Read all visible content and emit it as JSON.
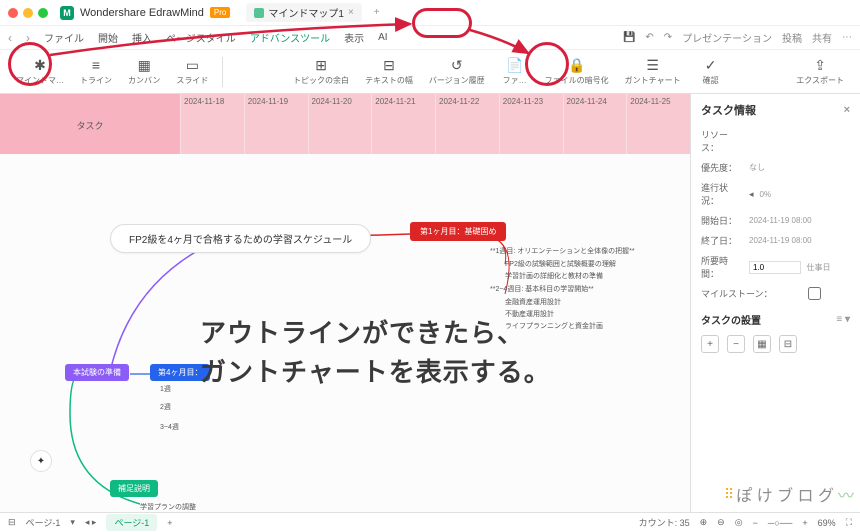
{
  "titlebar": {
    "app_name": "Wondershare EdrawMind",
    "pro": "Pro",
    "tab_name": "マインドマップ1",
    "plus": "+"
  },
  "menubar": {
    "items": [
      "ファイル",
      "開始",
      "挿入",
      "ページスタイル",
      "アドバンスツール",
      "表示",
      "AI"
    ],
    "active_index": 4,
    "right": {
      "presentation": "プレゼンテーション",
      "publish": "投稿",
      "share": "共有"
    }
  },
  "toolbar": {
    "mindmap": "マインドマ…",
    "outline": "トライン",
    "kanban": "カンバン",
    "slide": "スライド",
    "blank": "トピックの余白",
    "text_width": "テキストの幅",
    "version": "バージョン履歴",
    "file": "ファ…",
    "encrypt": "ファイルの暗号化",
    "gantt": "ガントチャート",
    "confirm": "確認",
    "export": "エクスポート"
  },
  "gantt": {
    "task_col": "タスク",
    "dates": [
      "2024-11-18",
      "2024-11-19",
      "2024-11-20",
      "2024-11-21",
      "2024-11-22",
      "2024-11-23",
      "2024-11-24",
      "2024-11-25"
    ]
  },
  "mindmap": {
    "root": "FP2級を4ヶ月で合格するための学習スケジュール",
    "month1": "第1ヶ月目：基礎固め",
    "m1_1": "**1週目: オリエンテーションと全体像の把握**",
    "m1_2": "FP2級の試験範囲と試験概要の理解",
    "m1_3": "学習計画の詳細化と教材の準備",
    "m1_4": "**2~4週目: 基本科目の学習開始**",
    "m1_5": "金融資産運用設計",
    "m1_6": "不動産運用設計",
    "m1_7": "ライフプランニングと資金計画",
    "trial": "本試験の準備",
    "month4": "第4ヶ月目：",
    "w1": "1週",
    "w2": "2週",
    "w34": "3~4週",
    "supplement": "補足説明",
    "supp_sub": "学習プランの調整"
  },
  "overlay": {
    "line1": "アウトラインができたら、",
    "line2": "ガントチャートを表示する。"
  },
  "panel": {
    "title": "タスク情報",
    "resource": "リソース：",
    "priority": "優先度：",
    "priority_val": "なし",
    "progress": "進行状況：",
    "progress_val": "0%",
    "start": "開始日：",
    "start_val": "2024-11-19 08:00",
    "end": "終了日：",
    "end_val": "2024-11-19 08:00",
    "duration": "所要時間：",
    "duration_val": "1.0",
    "duration_unit": "仕事日",
    "milestone": "マイルストーン：",
    "section2": "タスクの設置"
  },
  "status": {
    "page": "ページ-1",
    "page_tab": "ページ-1",
    "plus": "+",
    "count": "カウント: 35",
    "zoom": "69%"
  },
  "watermark": "ぽ け ブ ロ グ"
}
